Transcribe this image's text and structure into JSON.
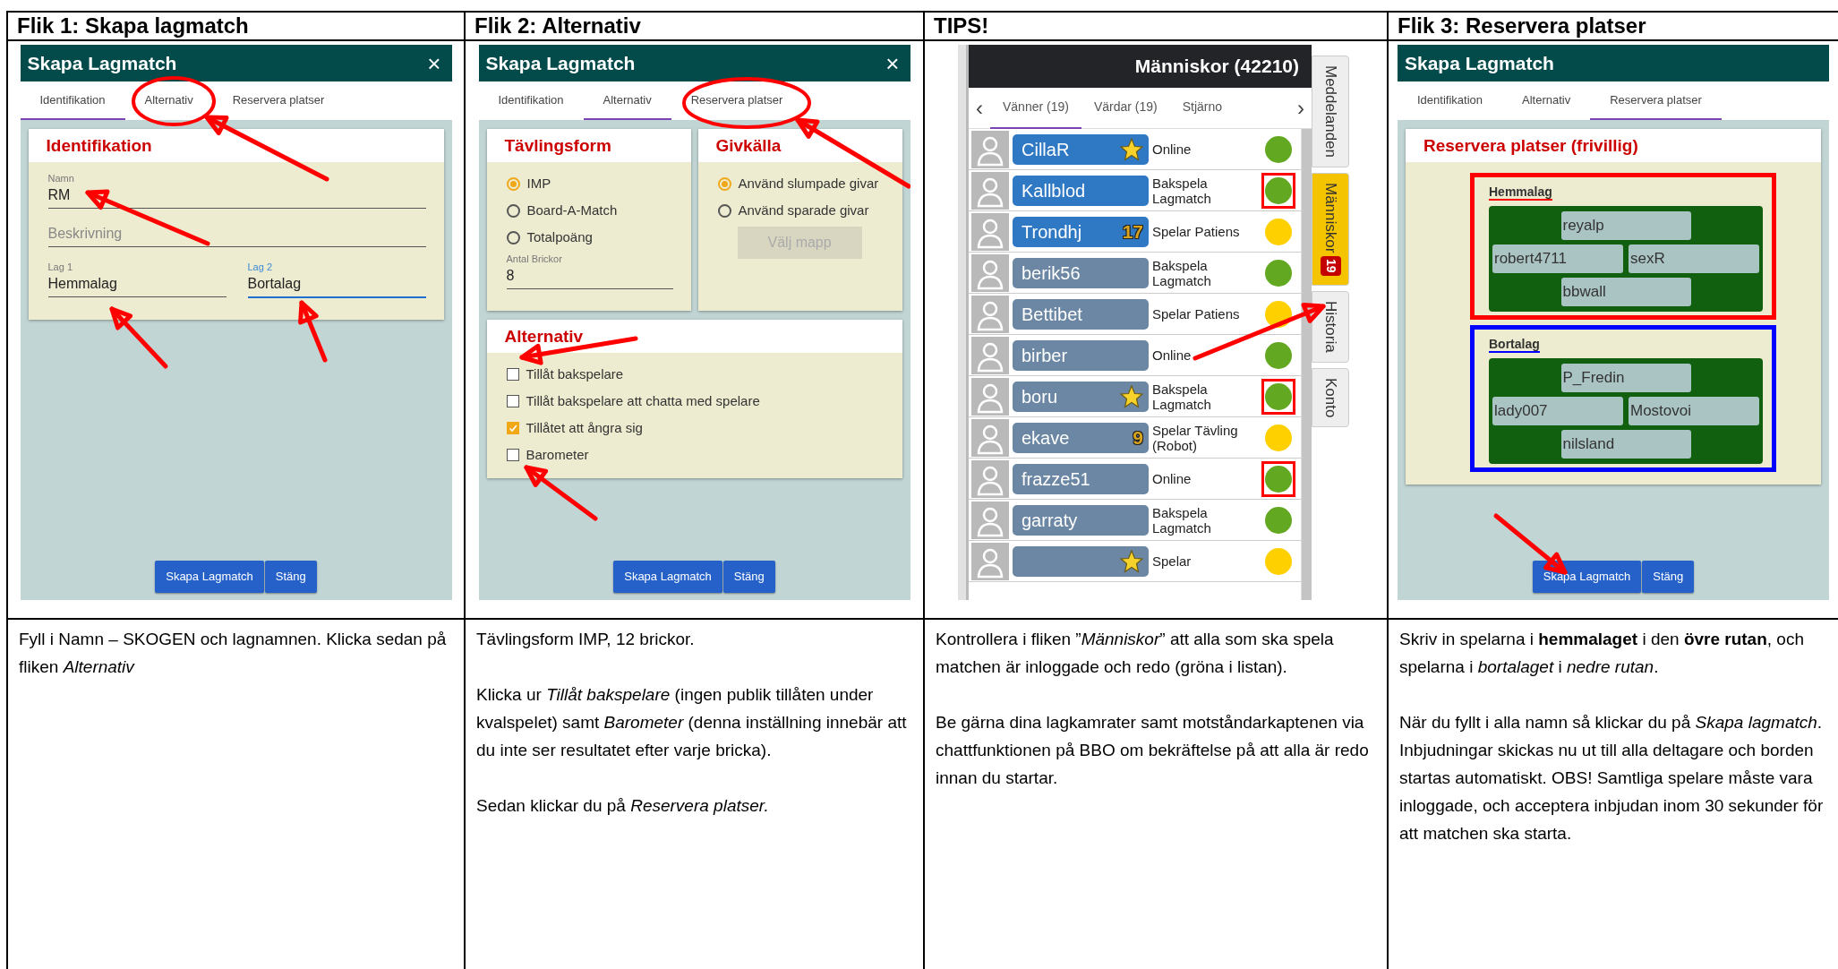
{
  "columns": [
    {
      "heading": "Flik 1: Skapa lagmatch",
      "screenshot": {
        "kind": "dialog",
        "title": "Skapa Lagmatch",
        "close": "×",
        "tabs": [
          {
            "label": "Identifikation",
            "selected": true
          },
          {
            "label": "Alternativ",
            "selected": false
          },
          {
            "label": "Reservera platser",
            "selected": false
          }
        ],
        "card_rows": [
          [
            {
              "title": "Identifikation",
              "items": [
                {
                  "kind": "field",
                  "label": "Namn",
                  "value": "RM",
                  "focused": false
                },
                {
                  "kind": "field",
                  "placeholder": "Beskrivning",
                  "focused": false
                },
                {
                  "kind": "fields",
                  "fields": [
                    {
                      "label": "Lag 1",
                      "value": "Hemmalag",
                      "focused": false
                    },
                    {
                      "label": "Lag 2",
                      "value": "Bortalag",
                      "focused": true
                    }
                  ]
                }
              ]
            }
          ]
        ],
        "buttons": [
          "Skapa Lagmatch",
          "Stäng"
        ]
      },
      "paragraphs": [
        "Fyll i Namn – SKOGEN och lagnamnen. Klicka sedan på fliken *Alternativ*"
      ]
    },
    {
      "heading": "Flik 2: Alternativ",
      "screenshot": {
        "kind": "dialog",
        "title": "Skapa Lagmatch",
        "close": "×",
        "tabs": [
          {
            "label": "Identifikation",
            "selected": false
          },
          {
            "label": "Alternativ",
            "selected": true
          },
          {
            "label": "Reservera platser",
            "selected": false
          }
        ],
        "card_rows": [
          [
            {
              "title": "Tävlingsform",
              "items": [
                {
                  "kind": "radio",
                  "label": "IMP",
                  "selected": true
                },
                {
                  "kind": "radio",
                  "label": "Board-A-Match",
                  "selected": false
                },
                {
                  "kind": "radio",
                  "label": "Totalpoäng",
                  "selected": false
                },
                {
                  "kind": "field",
                  "label": "Antal Brickor",
                  "value": "8",
                  "focused": false
                }
              ]
            },
            {
              "title": "Givkälla",
              "items": [
                {
                  "kind": "radio",
                  "label": "Använd slumpade givar",
                  "selected": true
                },
                {
                  "kind": "radio",
                  "label": "Använd sparade givar",
                  "selected": false
                },
                {
                  "kind": "button",
                  "label": "Välj mapp",
                  "disabled": true
                }
              ]
            }
          ],
          [
            {
              "title": "Alternativ",
              "items": [
                {
                  "kind": "checkbox",
                  "label": "Tillåt bakspelare",
                  "checked": false
                },
                {
                  "kind": "checkbox",
                  "label": "Tillåt bakspelare att chatta med spelare",
                  "checked": false
                },
                {
                  "kind": "checkbox",
                  "label": "Tillåtet att ångra sig",
                  "checked": true
                },
                {
                  "kind": "checkbox",
                  "label": "Barometer",
                  "checked": false
                }
              ]
            }
          ]
        ],
        "buttons": [
          "Skapa Lagmatch",
          "Stäng"
        ]
      },
      "paragraphs": [
        "Tävlingsform IMP, 12 brickor.",
        "Klicka ur *Tillåt bakspelare* (ingen publik tillåten under kvalspelet) samt *Barometer* (denna inställning innebär att du inte ser resultatet efter varje bricka).",
        "Sedan klickar du på *Reservera platser.*"
      ]
    },
    {
      "heading": "TIPS!",
      "screenshot": {
        "kind": "people_list",
        "title": "Människor (42210)",
        "prev": "‹",
        "next": "›",
        "tabs": [
          {
            "label": "Vänner (19)",
            "selected": true
          },
          {
            "label": "Värdar (19)",
            "selected": false
          },
          {
            "label": "Stjärno",
            "selected": false
          }
        ],
        "rows": [
          {
            "name": "CillaR",
            "starred": true,
            "status": "Online",
            "color": "#62a821",
            "highlighted": true,
            "marked": false
          },
          {
            "name": "Kallblod",
            "starred": false,
            "status": "Bakspela Lagmatch",
            "color": "#62a821",
            "highlighted": true,
            "marked": true
          },
          {
            "name": "Trondhj",
            "starred": false,
            "badge": "17",
            "status": "Spelar Patiens",
            "color": "#ffd000",
            "highlighted": true,
            "marked": false
          },
          {
            "name": "berik56",
            "starred": false,
            "status": "Bakspela Lagmatch",
            "color": "#62a821",
            "highlighted": false,
            "marked": false
          },
          {
            "name": "Bettibet",
            "starred": false,
            "status": "Spelar Patiens",
            "color": "#ffd000",
            "highlighted": false,
            "marked": false
          },
          {
            "name": "birber",
            "starred": false,
            "status": "Online",
            "color": "#62a821",
            "highlighted": false,
            "marked": false
          },
          {
            "name": "boru",
            "starred": true,
            "status": "Bakspela Lagmatch",
            "color": "#62a821",
            "highlighted": false,
            "marked": true
          },
          {
            "name": "ekave",
            "starred": false,
            "badge": "9",
            "status": "Spelar Tävling (Robot)",
            "color": "#ffd000",
            "highlighted": false,
            "marked": false
          },
          {
            "name": "frazze51",
            "starred": false,
            "status": "Online",
            "color": "#62a821",
            "highlighted": false,
            "marked": true
          },
          {
            "name": "garraty",
            "starred": false,
            "status": "Bakspela Lagmatch",
            "color": "#62a821",
            "highlighted": false,
            "marked": false
          },
          {
            "starred": true,
            "status": "Spelar",
            "color": "#ffd000",
            "highlighted": false,
            "marked": false
          }
        ],
        "side_tabs": [
          {
            "label": "Meddelanden",
            "selected": false
          },
          {
            "label": "Människor",
            "selected": true,
            "badge": "19"
          },
          {
            "label": "Historia",
            "selected": false
          },
          {
            "label": "Konto",
            "selected": false
          }
        ]
      },
      "paragraphs": [
        "Kontrollera i fliken ”*Människor*” att alla som ska spela matchen är inloggade och redo (gröna i listan).",
        "Be gärna dina lagkamrater samt motståndarkaptenen via chattfunktionen på BBO om bekräftelse på att alla är redo innan du startar."
      ]
    },
    {
      "heading": "Flik 3: Reservera platser",
      "screenshot": {
        "kind": "dialog",
        "title": "Skapa Lagmatch",
        "tabs": [
          {
            "label": "Identifikation",
            "selected": false
          },
          {
            "label": "Alternativ",
            "selected": false
          },
          {
            "label": "Reservera platser",
            "selected": true
          }
        ],
        "card_rows": [
          [
            {
              "title": "Reservera platser (frivillig)",
              "items": [
                {
                  "kind": "team",
                  "label": "Hemmalag",
                  "color": "#ff0000",
                  "players": [
                    "reyalp",
                    "robert4711",
                    "sexR",
                    "bbwall"
                  ]
                },
                {
                  "kind": "team",
                  "label": "Bortalag",
                  "color": "#0000ff",
                  "players": [
                    "P_Fredin",
                    "lady007",
                    "Mostovoi",
                    "nilsland"
                  ]
                }
              ]
            }
          ]
        ],
        "buttons": [
          "Skapa Lagmatch",
          "Stäng"
        ]
      },
      "paragraphs": [
        "Skriv in spelarna i **hemmalaget** i den **övre rutan**, och spelarna i *bortalaget* i *nedre rutan*.",
        "När du fyllt i alla namn så klickar du på *Skapa lagmatch*. Inbjudningar skickas nu ut till alla deltagare och borden startas automatiskt. OBS! Samtliga spelare måste vara inloggade, och acceptera inbjudan inom 30 sekunder för att matchen ska starta."
      ]
    }
  ]
}
